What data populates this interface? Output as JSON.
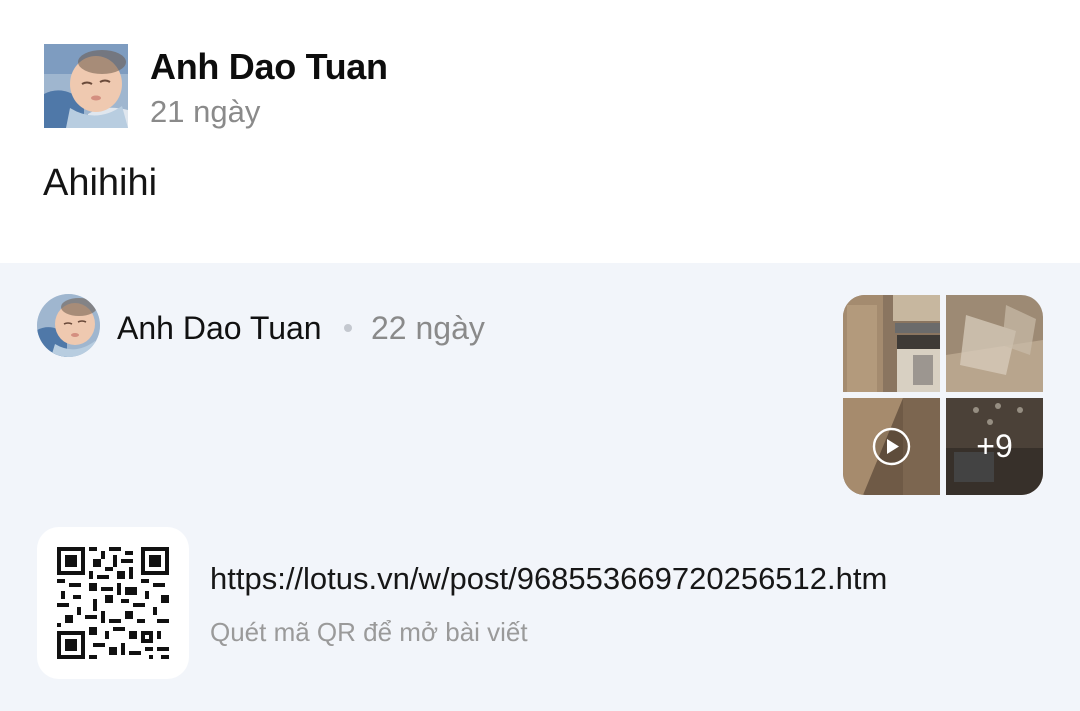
{
  "post": {
    "author": "Anh Dao Tuan",
    "time": "21 ngày",
    "text": "Ahihihi",
    "avatar_icon": "baby-photo-avatar"
  },
  "shared": {
    "author": "Anh Dao Tuan",
    "time": "22 ngày",
    "media": {
      "tiles": [
        {
          "kind": "photo",
          "icon": "kitchen-photo"
        },
        {
          "kind": "photo",
          "icon": "room-photo"
        },
        {
          "kind": "video",
          "icon": "play-icon"
        },
        {
          "kind": "photo",
          "icon": "ceiling-photo"
        }
      ],
      "more_count": "+9"
    }
  },
  "link": {
    "url": "https://lotus.vn/w/post/968553669720256512.htm",
    "hint": "Quét mã QR để mở bài viết",
    "qr_icon": "qr-code-icon"
  },
  "colors": {
    "card_background": "#f2f5fa",
    "secondary_text": "#8a8a8a"
  }
}
